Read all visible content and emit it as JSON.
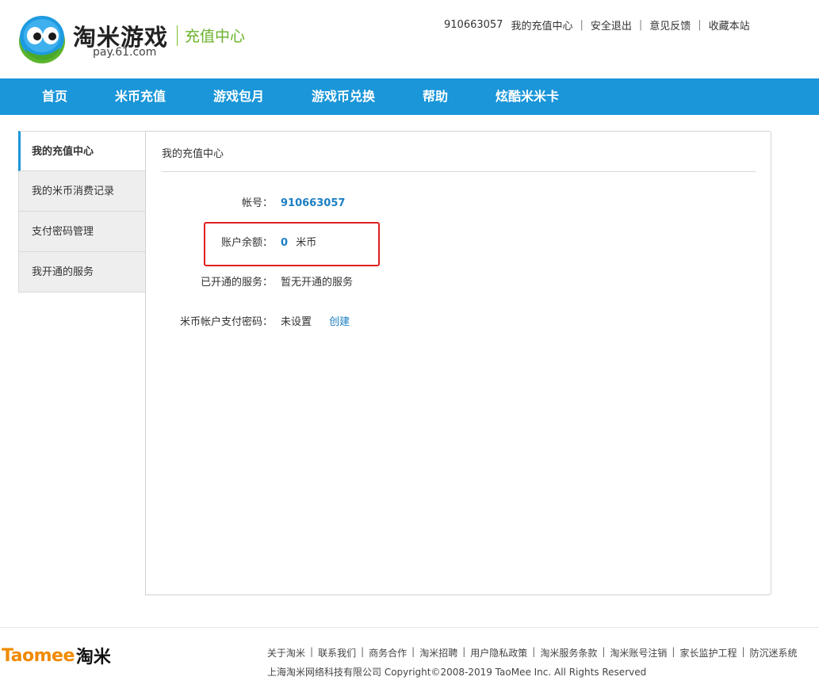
{
  "header": {
    "logo_title": "淘米游戏",
    "logo_url": "pay.61.com",
    "logo_sub": "充值中心",
    "top_links": {
      "user_id": "910663057",
      "my_center": "我的充值中心",
      "logout": "安全退出",
      "feedback": "意见反馈",
      "bookmark": "收藏本站",
      "separator": "|"
    }
  },
  "nav": {
    "items": [
      {
        "label": "首页"
      },
      {
        "label": "米币充值"
      },
      {
        "label": "游戏包月"
      },
      {
        "label": "游戏币兑换"
      },
      {
        "label": "帮助"
      },
      {
        "label": "炫酷米米卡"
      }
    ]
  },
  "sidebar": {
    "items": [
      {
        "label": "我的充值中心",
        "active": true
      },
      {
        "label": "我的米币消费记录"
      },
      {
        "label": "支付密码管理"
      },
      {
        "label": "我开通的服务"
      }
    ]
  },
  "main": {
    "title": "我的充值中心",
    "rows": {
      "account": {
        "label": "帐号：",
        "value": "910663057"
      },
      "balance": {
        "label": "账户余额：",
        "value": "0",
        "unit": "米币"
      },
      "services": {
        "label": "已开通的服务：",
        "value": "暂无开通的服务"
      },
      "pay_password": {
        "label": "米币帐户支付密码：",
        "value": "未设置",
        "action": "创建"
      }
    }
  },
  "footer": {
    "logo_en": "Taomee",
    "logo_cn": "淘米",
    "links": [
      "关于淘米",
      "联系我们",
      "商务合作",
      "淘米招聘",
      "用户隐私政策",
      "淘米服务条款",
      "淘米账号注销",
      "家长监护工程",
      "防沉迷系统"
    ],
    "separator": "|",
    "copyright": "上海淘米网络科技有限公司 Copyright©2008-2019 TaoMee Inc. All Rights Reserved"
  },
  "colors": {
    "nav_bg": "#1b96d9",
    "link_blue": "#1b7fc3",
    "logo_green": "#6ab22a",
    "highlight_red": "#e02020",
    "footer_orange": "#f08a00"
  }
}
